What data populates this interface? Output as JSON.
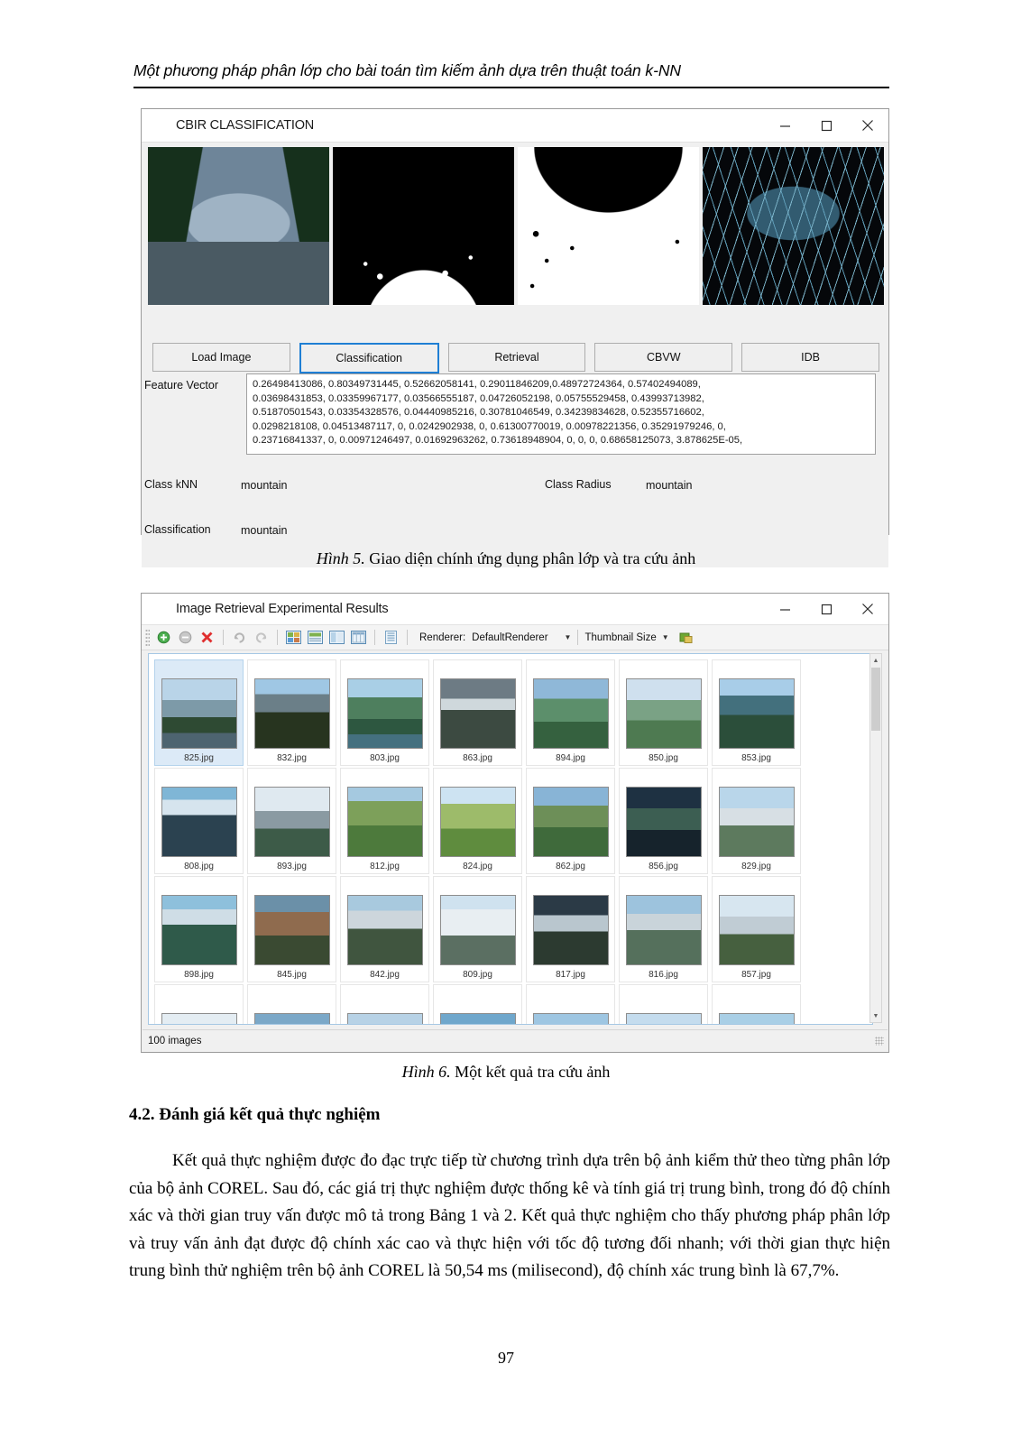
{
  "document": {
    "running_head": "Một phương pháp phân lớp cho bài toán tìm kiếm ảnh dựa trên thuật toán k-NN",
    "page_number": "97",
    "section_heading": "4.2. Đánh giá kết quả thực nghiệm",
    "paragraph": "Kết quả thực nghiệm được đo đạc trực tiếp từ chương trình dựa trên bộ ảnh kiểm thử theo từng phân lớp của bộ ảnh COREL. Sau đó, các giá trị thực nghiệm được thống kê và tính giá trị trung bình, trong đó độ chính xác và thời gian truy vấn được mô tả trong Bảng 1 và 2. Kết quả thực nghiệm cho thấy phương pháp phân lớp và truy vấn ảnh đạt được độ chính xác cao và thực hiện với tốc độ tương đối nhanh; với thời gian thực hiện trung bình thử nghiệm trên bộ ảnh COREL là 50,54 ms (milisecond), độ chính xác trung bình là 67,7%."
  },
  "figure5": {
    "caption_label": "Hình 5.",
    "caption_text": " Giao diện chính ứng dụng phân lớp và tra cứu ảnh"
  },
  "figure6": {
    "caption_label": "Hình 6.",
    "caption_text": " Một kết quả tra cứu ảnh"
  },
  "window1": {
    "title": "CBIR CLASSIFICATION",
    "icon": "gear-icon",
    "controls": {
      "minimize": "–",
      "maximize": "□",
      "close": "✕"
    },
    "preview_images": [
      {
        "name": "original-lake-mountain-photo"
      },
      {
        "name": "binary-mask-image-1"
      },
      {
        "name": "binary-mask-image-2"
      },
      {
        "name": "edge-detection-image"
      }
    ],
    "buttons": [
      {
        "label": "Load Image",
        "focused": false
      },
      {
        "label": "Classification",
        "focused": true
      },
      {
        "label": "Retrieval",
        "focused": false
      },
      {
        "label": "CBVW",
        "focused": false
      },
      {
        "label": "IDB",
        "focused": false
      }
    ],
    "feature_vector_label": "Feature Vector",
    "feature_vector_value": "0.26498413086, 0.80349731445, 0.52662058141, 0.29011846209,0.48972724364, 0.57402494089,\n0.03698431853, 0.03359967177, 0.03566555187, 0.04726052198, 0.05755529458, 0.43993713982,\n0.51870501543, 0.03354328576, 0.04440985216, 0.30781046549, 0.34239834628, 0.52355716602,\n0.0298218108, 0.04513487117, 0, 0.0242902938, 0, 0.61300770019, 0.00978221356, 0.35291979246, 0,\n0.23716841337, 0, 0.00971246497, 0.01692963262, 0.73618948904, 0, 0, 0, 0.68658125073, 3.878625E-05,",
    "fields": [
      {
        "label": "Class kNN",
        "value": "mountain"
      },
      {
        "label": "Class Radius",
        "value": "mountain"
      },
      {
        "label": "Classification",
        "value": "mountain"
      }
    ]
  },
  "window2": {
    "title": "Image Retrieval Experimental Results",
    "icon": "gear-icon",
    "controls": {
      "minimize": "–",
      "maximize": "□",
      "close": "✕"
    },
    "toolbar": {
      "icons": [
        "add-icon",
        "remove-icon",
        "delete-icon",
        "redo-icon",
        "undo-icon",
        "view-thumbnails-icon",
        "view-details-icon",
        "view-split-icon",
        "view-grid-icon",
        "view-list-icon"
      ],
      "renderer_label": "Renderer:",
      "renderer_value": "DefaultRenderer",
      "thumbnail_size_label": "Thumbnail Size",
      "export-icon": "export-icon"
    },
    "status_text": "100 images",
    "scrollbar": {
      "up_arrow": "▲",
      "down_arrow": "▼"
    },
    "thumbnails": [
      {
        "label": "825.jpg",
        "selected": true
      },
      {
        "label": "832.jpg",
        "selected": false
      },
      {
        "label": "803.jpg",
        "selected": false
      },
      {
        "label": "863.jpg",
        "selected": false
      },
      {
        "label": "894.jpg",
        "selected": false
      },
      {
        "label": "850.jpg",
        "selected": false
      },
      {
        "label": "853.jpg",
        "selected": false
      },
      {
        "label": "808.jpg",
        "selected": false
      },
      {
        "label": "893.jpg",
        "selected": false
      },
      {
        "label": "812.jpg",
        "selected": false
      },
      {
        "label": "824.jpg",
        "selected": false
      },
      {
        "label": "862.jpg",
        "selected": false
      },
      {
        "label": "856.jpg",
        "selected": false
      },
      {
        "label": "829.jpg",
        "selected": false
      },
      {
        "label": "898.jpg",
        "selected": false
      },
      {
        "label": "845.jpg",
        "selected": false
      },
      {
        "label": "842.jpg",
        "selected": false
      },
      {
        "label": "809.jpg",
        "selected": false
      },
      {
        "label": "817.jpg",
        "selected": false
      },
      {
        "label": "816.jpg",
        "selected": false
      },
      {
        "label": "857.jpg",
        "selected": false
      },
      {
        "label": "",
        "selected": false
      },
      {
        "label": "",
        "selected": false
      },
      {
        "label": "",
        "selected": false
      },
      {
        "label": "",
        "selected": false
      },
      {
        "label": "",
        "selected": false
      },
      {
        "label": "",
        "selected": false
      },
      {
        "label": "",
        "selected": false
      }
    ]
  }
}
